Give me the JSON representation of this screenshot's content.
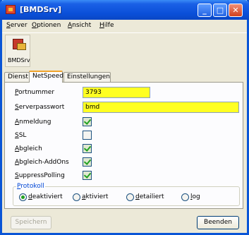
{
  "window": {
    "title": "[BMDSrv]"
  },
  "menu": {
    "items": [
      "Server",
      "Optionen",
      "Ansicht",
      "Hilfe"
    ]
  },
  "toolbar": {
    "button_label": "BMDSrv"
  },
  "tabs": {
    "items": [
      "Dienst",
      "NetSpeed",
      "Einstellungen"
    ],
    "active": "NetSpeed"
  },
  "form": {
    "port_label": "Portnummer",
    "port_value": "3793",
    "password_label": "Serverpasswort",
    "password_value": "bmd",
    "checks": [
      {
        "label": "Anmeldung",
        "checked": true
      },
      {
        "label": "SSL",
        "checked": false
      },
      {
        "label": "Abgleich",
        "checked": true
      },
      {
        "label": "Abgleich-AddOns",
        "checked": true
      },
      {
        "label": "SuppressPolling",
        "checked": true
      }
    ],
    "protocol": {
      "title": "Protokoll",
      "options": [
        "deaktiviert",
        "aktiviert",
        "detailiert",
        "log"
      ],
      "selected": "deaktiviert"
    }
  },
  "buttons": {
    "save": "Speichern",
    "close": "Beenden"
  },
  "colors": {
    "titlebar": "#0a4fd8",
    "field_background": "#ffff22",
    "check": "#21a121",
    "group_title": "#0046d5"
  }
}
